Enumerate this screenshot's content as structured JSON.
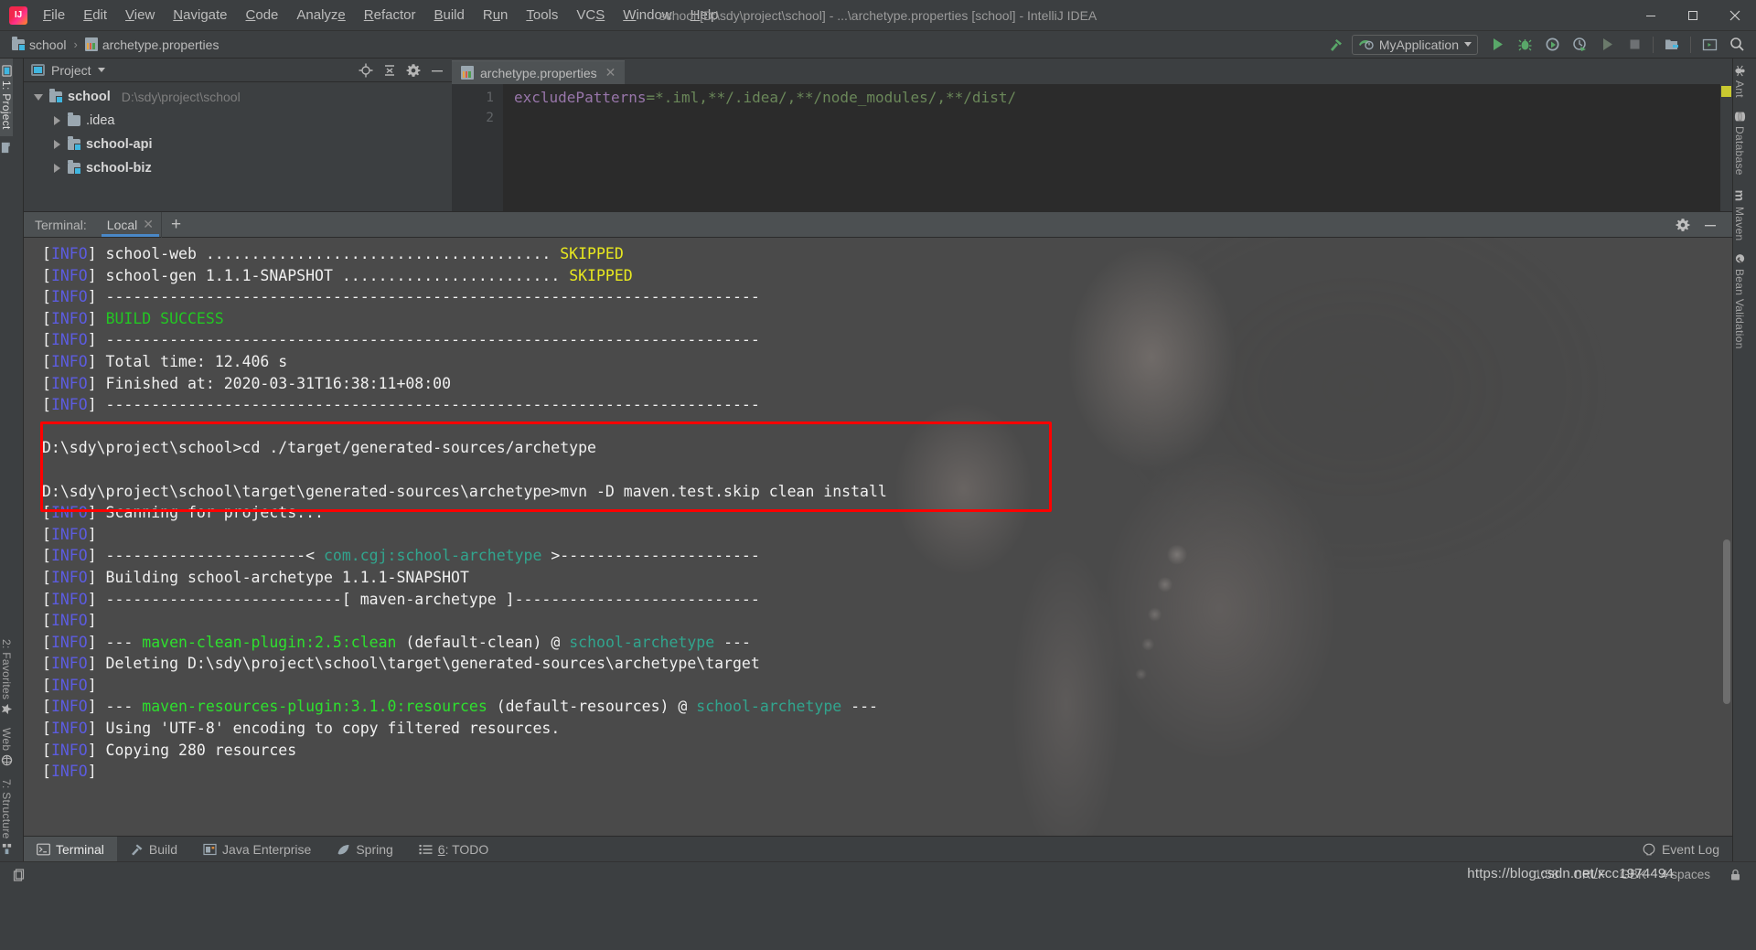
{
  "window": {
    "title": "school [D:\\sdy\\project\\school] - ...\\archetype.properties [school] - IntelliJ IDEA",
    "logo_icon": "intellij-idea-logo",
    "minimize_icon": "minimize-icon",
    "maximize_icon": "maximize-icon",
    "close_icon": "close-icon"
  },
  "menubar": {
    "items": [
      {
        "label": "File"
      },
      {
        "label": "Edit"
      },
      {
        "label": "View"
      },
      {
        "label": "Navigate"
      },
      {
        "label": "Code"
      },
      {
        "label": "Analyze"
      },
      {
        "label": "Refactor"
      },
      {
        "label": "Build"
      },
      {
        "label": "Run"
      },
      {
        "label": "Tools"
      },
      {
        "label": "VCS"
      },
      {
        "label": "Window"
      },
      {
        "label": "Help"
      }
    ]
  },
  "navbar": {
    "breadcrumb": [
      {
        "label": "school",
        "icon": "folder-module-icon"
      },
      {
        "label": "archetype.properties",
        "icon": "properties-file-icon"
      }
    ],
    "separator": "›",
    "run_config": {
      "name": "MyApplication",
      "icon": "spring-boot-icon",
      "dropdown_icon": "chevron-down-icon"
    },
    "actions": [
      {
        "name": "build-hammer-icon"
      },
      {
        "name": "run-icon"
      },
      {
        "name": "debug-icon"
      },
      {
        "name": "run-coverage-icon"
      },
      {
        "name": "profile-icon"
      },
      {
        "name": "rerun-icon"
      },
      {
        "name": "stop-icon"
      },
      {
        "name": "project-structure-icon"
      },
      {
        "name": "terminal-window-icon"
      },
      {
        "name": "search-everywhere-icon"
      }
    ]
  },
  "left_rail": {
    "top": [
      {
        "label": "1: Project",
        "icon": "project-icon",
        "active": true
      },
      {
        "label": "",
        "icon": "folder-icon",
        "active": false
      }
    ],
    "bottom": [
      {
        "label": "2: Favorites",
        "icon": "star-icon"
      },
      {
        "label": "Web",
        "icon": "web-icon"
      },
      {
        "label": "7: Structure",
        "icon": "structure-icon"
      }
    ]
  },
  "right_rail": {
    "items": [
      {
        "label": "Ant",
        "icon": "ant-icon"
      },
      {
        "label": "Database",
        "icon": "database-icon"
      },
      {
        "label": "Maven",
        "icon": "maven-icon"
      },
      {
        "label": "Bean Validation",
        "icon": "bean-validation-icon"
      }
    ]
  },
  "project_panel": {
    "title": "Project",
    "title_icon": "project-view-icon",
    "dropdown_icon": "chevron-down-icon",
    "actions": [
      {
        "name": "locate-target-icon"
      },
      {
        "name": "collapse-all-icon"
      },
      {
        "name": "gear-icon"
      },
      {
        "name": "hide-panel-icon"
      }
    ],
    "tree": [
      {
        "label": "school",
        "path": "D:\\sdy\\project\\school",
        "icon": "folder-module-icon",
        "expanded": true,
        "depth": 0,
        "bold": true
      },
      {
        "label": ".idea",
        "path": "",
        "icon": "folder-icon",
        "expanded": false,
        "depth": 1,
        "bold": false
      },
      {
        "label": "school-api",
        "path": "",
        "icon": "folder-module-icon",
        "expanded": false,
        "depth": 1,
        "bold": true
      },
      {
        "label": "school-biz",
        "path": "",
        "icon": "folder-module-icon",
        "expanded": false,
        "depth": 1,
        "bold": true
      }
    ]
  },
  "editor": {
    "tab": {
      "label": "archetype.properties",
      "icon": "properties-file-icon",
      "close_icon": "close-icon"
    },
    "line_numbers": [
      "1",
      "2"
    ],
    "code": {
      "key": "excludePatterns",
      "equals": "=",
      "value": "*.iml,**/.idea/,**/node_modules/,**/dist/"
    }
  },
  "terminal": {
    "label": "Terminal:",
    "tabs": [
      {
        "label": "Local",
        "close_icon": "close-icon",
        "active": true
      }
    ],
    "add_icon": "plus-icon",
    "actions": [
      {
        "name": "gear-icon"
      },
      {
        "name": "hide-panel-icon"
      }
    ],
    "lines": [
      {
        "segs": [
          {
            "t": "[",
            "c": "white"
          },
          {
            "t": "INFO",
            "c": "info"
          },
          {
            "t": "] school-web ...................................... ",
            "c": "white"
          },
          {
            "t": "SKIPPED",
            "c": "skip"
          }
        ]
      },
      {
        "segs": [
          {
            "t": "[",
            "c": "white"
          },
          {
            "t": "INFO",
            "c": "info"
          },
          {
            "t": "] school-gen 1.1.1-SNAPSHOT ........................ ",
            "c": "white"
          },
          {
            "t": "SKIPPED",
            "c": "skip"
          }
        ]
      },
      {
        "segs": [
          {
            "t": "[",
            "c": "white"
          },
          {
            "t": "INFO",
            "c": "info"
          },
          {
            "t": "] ------------------------------------------------------------------------",
            "c": "white"
          }
        ]
      },
      {
        "segs": [
          {
            "t": "[",
            "c": "white"
          },
          {
            "t": "INFO",
            "c": "info"
          },
          {
            "t": "] ",
            "c": "white"
          },
          {
            "t": "BUILD SUCCESS",
            "c": "ok"
          }
        ]
      },
      {
        "segs": [
          {
            "t": "[",
            "c": "white"
          },
          {
            "t": "INFO",
            "c": "info"
          },
          {
            "t": "] ------------------------------------------------------------------------",
            "c": "white"
          }
        ]
      },
      {
        "segs": [
          {
            "t": "[",
            "c": "white"
          },
          {
            "t": "INFO",
            "c": "info"
          },
          {
            "t": "] Total time: 12.406 s",
            "c": "white"
          }
        ]
      },
      {
        "segs": [
          {
            "t": "[",
            "c": "white"
          },
          {
            "t": "INFO",
            "c": "info"
          },
          {
            "t": "] Finished at: 2020-03-31T16:38:11+08:00",
            "c": "white"
          }
        ]
      },
      {
        "segs": [
          {
            "t": "[",
            "c": "white"
          },
          {
            "t": "INFO",
            "c": "info"
          },
          {
            "t": "] ------------------------------------------------------------------------",
            "c": "white"
          }
        ]
      },
      {
        "segs": []
      },
      {
        "segs": [
          {
            "t": "D:\\sdy\\project\\school>cd ./target/generated-sources/archetype",
            "c": "white"
          }
        ]
      },
      {
        "segs": []
      },
      {
        "segs": [
          {
            "t": "D:\\sdy\\project\\school\\target\\generated-sources\\archetype>mvn -D maven.test.skip clean install",
            "c": "white"
          }
        ]
      },
      {
        "segs": [
          {
            "t": "[",
            "c": "white"
          },
          {
            "t": "INFO",
            "c": "info"
          },
          {
            "t": "] Scanning for projects...",
            "c": "white"
          }
        ]
      },
      {
        "segs": [
          {
            "t": "[",
            "c": "white"
          },
          {
            "t": "INFO",
            "c": "info"
          },
          {
            "t": "]",
            "c": "white"
          }
        ]
      },
      {
        "segs": [
          {
            "t": "[",
            "c": "white"
          },
          {
            "t": "INFO",
            "c": "info"
          },
          {
            "t": "] ----------------------< ",
            "c": "white"
          },
          {
            "t": "com.cgj:school-archetype",
            "c": "teal"
          },
          {
            "t": " >----------------------",
            "c": "white"
          }
        ]
      },
      {
        "segs": [
          {
            "t": "[",
            "c": "white"
          },
          {
            "t": "INFO",
            "c": "info"
          },
          {
            "t": "] Building school-archetype 1.1.1-SNAPSHOT",
            "c": "white"
          }
        ]
      },
      {
        "segs": [
          {
            "t": "[",
            "c": "white"
          },
          {
            "t": "INFO",
            "c": "info"
          },
          {
            "t": "] --------------------------[ maven-archetype ]---------------------------",
            "c": "white"
          }
        ]
      },
      {
        "segs": [
          {
            "t": "[",
            "c": "white"
          },
          {
            "t": "INFO",
            "c": "info"
          },
          {
            "t": "]",
            "c": "white"
          }
        ]
      },
      {
        "segs": [
          {
            "t": "[",
            "c": "white"
          },
          {
            "t": "INFO",
            "c": "info"
          },
          {
            "t": "] --- ",
            "c": "white"
          },
          {
            "t": "maven-clean-plugin:2.5:clean",
            "c": "green"
          },
          {
            "t": " (default-clean) @ ",
            "c": "white"
          },
          {
            "t": "school-archetype",
            "c": "teal"
          },
          {
            "t": " ---",
            "c": "white"
          }
        ]
      },
      {
        "segs": [
          {
            "t": "[",
            "c": "white"
          },
          {
            "t": "INFO",
            "c": "info"
          },
          {
            "t": "] Deleting D:\\sdy\\project\\school\\target\\generated-sources\\archetype\\target",
            "c": "white"
          }
        ]
      },
      {
        "segs": [
          {
            "t": "[",
            "c": "white"
          },
          {
            "t": "INFO",
            "c": "info"
          },
          {
            "t": "]",
            "c": "white"
          }
        ]
      },
      {
        "segs": [
          {
            "t": "[",
            "c": "white"
          },
          {
            "t": "INFO",
            "c": "info"
          },
          {
            "t": "] --- ",
            "c": "white"
          },
          {
            "t": "maven-resources-plugin:3.1.0:resources",
            "c": "green"
          },
          {
            "t": " (default-resources) @ ",
            "c": "white"
          },
          {
            "t": "school-archetype",
            "c": "teal"
          },
          {
            "t": " ---",
            "c": "white"
          }
        ]
      },
      {
        "segs": [
          {
            "t": "[",
            "c": "white"
          },
          {
            "t": "INFO",
            "c": "info"
          },
          {
            "t": "] Using 'UTF-8' encoding to copy filtered resources.",
            "c": "white"
          }
        ]
      },
      {
        "segs": [
          {
            "t": "[",
            "c": "white"
          },
          {
            "t": "INFO",
            "c": "info"
          },
          {
            "t": "] Copying 280 resources",
            "c": "white"
          }
        ]
      },
      {
        "segs": [
          {
            "t": "[",
            "c": "white"
          },
          {
            "t": "INFO",
            "c": "info"
          },
          {
            "t": "]",
            "c": "white"
          }
        ]
      }
    ]
  },
  "bottom_tabs": {
    "items": [
      {
        "label": "Terminal",
        "icon": "terminal-icon",
        "active": true
      },
      {
        "label": "Build",
        "icon": "hammer-icon",
        "active": false
      },
      {
        "label": "Java Enterprise",
        "icon": "java-enterprise-icon",
        "active": false
      },
      {
        "label": "Spring",
        "icon": "spring-leaf-icon",
        "active": false
      },
      {
        "label": "6: TODO",
        "icon": "todo-list-icon",
        "active": false
      }
    ],
    "event_log": {
      "label": "Event Log",
      "icon": "event-log-icon"
    }
  },
  "statusbar": {
    "left_icon": "toggle-layout-icon",
    "caret_position": "1:58",
    "line_separator": "CRLF",
    "encoding": "GBK",
    "indent": "4 spaces",
    "lock_icon": "read-only-lock-icon",
    "watermark": "https://blog.csdn.net/xcc1974494"
  },
  "colors": {
    "accent_blue": "#4a88c7",
    "panel_bg": "#3c3f41",
    "editor_bg": "#2b2b2b",
    "terminal_bg": "#4a4a4a",
    "highlight_red": "#ff0000",
    "info_blue": "#5c5ce0",
    "skipped_yellow": "#e8e81f",
    "success_green": "#23c723",
    "plugin_green": "#2ee02e",
    "artifact_teal": "#31a58e"
  }
}
